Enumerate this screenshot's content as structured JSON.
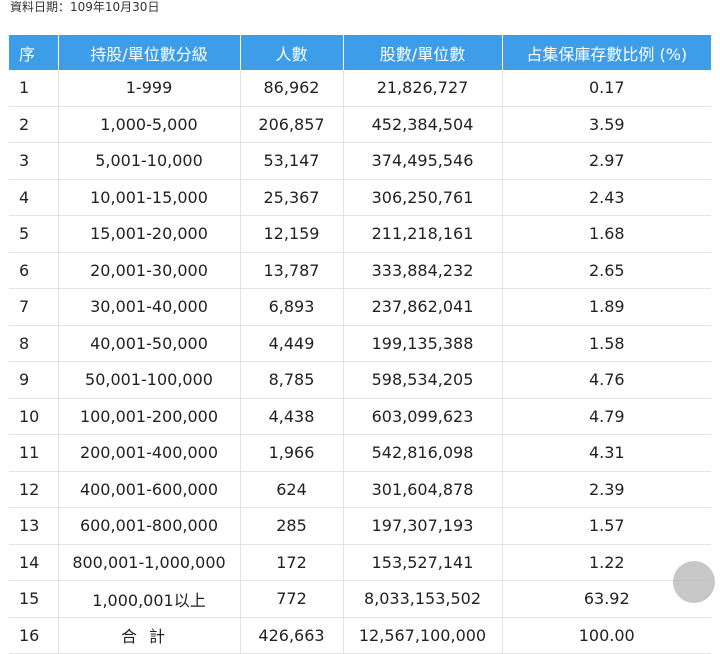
{
  "date_line": "資料日期：109年10月30日",
  "table": {
    "headers": [
      "序",
      "持股/單位數分級",
      "人數",
      "股數/單位數",
      "占集保庫存數比例 (%)"
    ],
    "rows": [
      [
        "1",
        "1-999",
        "86,962",
        "21,826,727",
        "0.17"
      ],
      [
        "2",
        "1,000-5,000",
        "206,857",
        "452,384,504",
        "3.59"
      ],
      [
        "3",
        "5,001-10,000",
        "53,147",
        "374,495,546",
        "2.97"
      ],
      [
        "4",
        "10,001-15,000",
        "25,367",
        "306,250,761",
        "2.43"
      ],
      [
        "5",
        "15,001-20,000",
        "12,159",
        "211,218,161",
        "1.68"
      ],
      [
        "6",
        "20,001-30,000",
        "13,787",
        "333,884,232",
        "2.65"
      ],
      [
        "7",
        "30,001-40,000",
        "6,893",
        "237,862,041",
        "1.89"
      ],
      [
        "8",
        "40,001-50,000",
        "4,449",
        "199,135,388",
        "1.58"
      ],
      [
        "9",
        "50,001-100,000",
        "8,785",
        "598,534,205",
        "4.76"
      ],
      [
        "10",
        "100,001-200,000",
        "4,438",
        "603,099,623",
        "4.79"
      ],
      [
        "11",
        "200,001-400,000",
        "1,966",
        "542,816,098",
        "4.31"
      ],
      [
        "12",
        "400,001-600,000",
        "624",
        "301,604,878",
        "2.39"
      ],
      [
        "13",
        "600,001-800,000",
        "285",
        "197,307,193",
        "1.57"
      ],
      [
        "14",
        "800,001-1,000,000",
        "172",
        "153,527,141",
        "1.22"
      ],
      [
        "15",
        "1,000,001以上",
        "772",
        "8,033,153,502",
        "63.92"
      ],
      [
        "16",
        "合計",
        "426,663",
        "12,567,100,000",
        "100.00"
      ]
    ]
  },
  "colors": {
    "header_bg": "#3d9de9",
    "header_text": "#ffffff",
    "border": "#e3e3e3"
  }
}
